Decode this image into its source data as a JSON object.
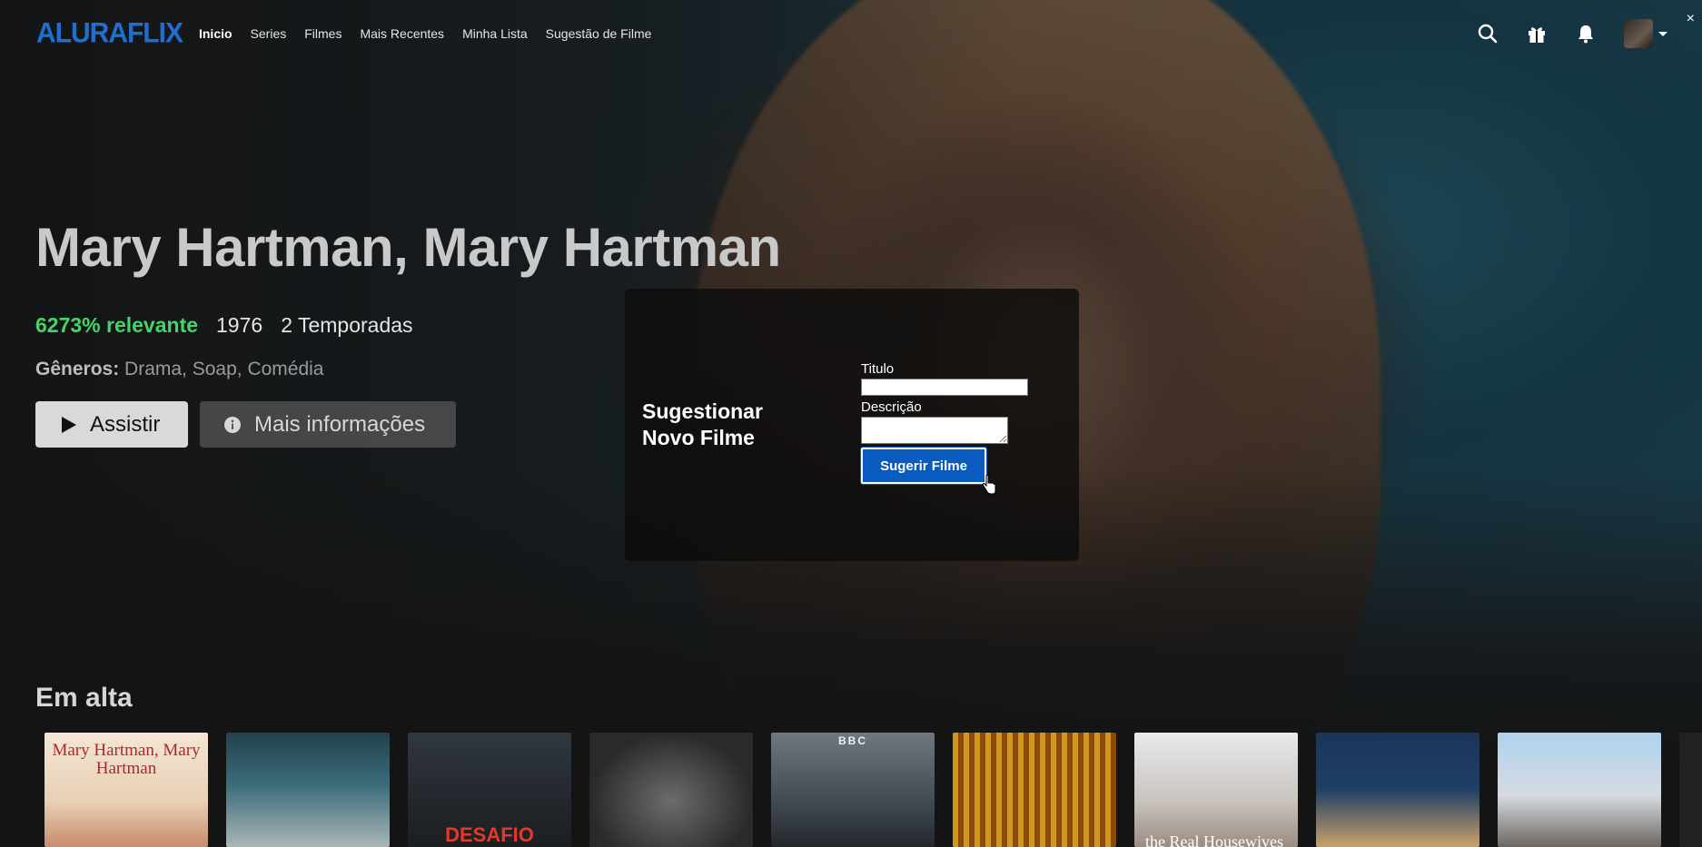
{
  "nav": {
    "logo": "ALURAFLIX",
    "links": [
      "Inicio",
      "Series",
      "Filmes",
      "Mais Recentes",
      "Minha Lista",
      "Sugestão de Filme"
    ],
    "icons": [
      "search-icon",
      "gift-icon",
      "bell-icon",
      "avatar"
    ],
    "close": "×"
  },
  "hero": {
    "title": "Mary Hartman, Mary Hartman",
    "relevance": "6273% relevante",
    "year": "1976",
    "seasons": "2 Temporadas",
    "genres_label": "Gêneros:",
    "genres": "Drama, Soap, Comédia",
    "play_label": "Assistir",
    "info_label": "Mais informações"
  },
  "modal": {
    "title": "Sugestionar Novo Filme",
    "title_label": "Titulo",
    "title_value": "",
    "description_label": "Descrição",
    "description_value": "",
    "submit_label": "Sugerir Filme"
  },
  "row": {
    "title": "Em alta",
    "posters": [
      {
        "text": "Mary Hartman, Mary Hartman"
      },
      {
        "text": ""
      },
      {
        "text": "DESAFIO"
      },
      {
        "text": ""
      },
      {
        "text": "BBC"
      },
      {
        "text": ""
      },
      {
        "text": "the Real Housewives"
      },
      {
        "text": ""
      },
      {
        "text": ""
      },
      {
        "text": ""
      }
    ]
  },
  "colors": {
    "logo": "#1f6fd1",
    "relevance": "#46d369",
    "submit_button": "#0a5bbf"
  }
}
